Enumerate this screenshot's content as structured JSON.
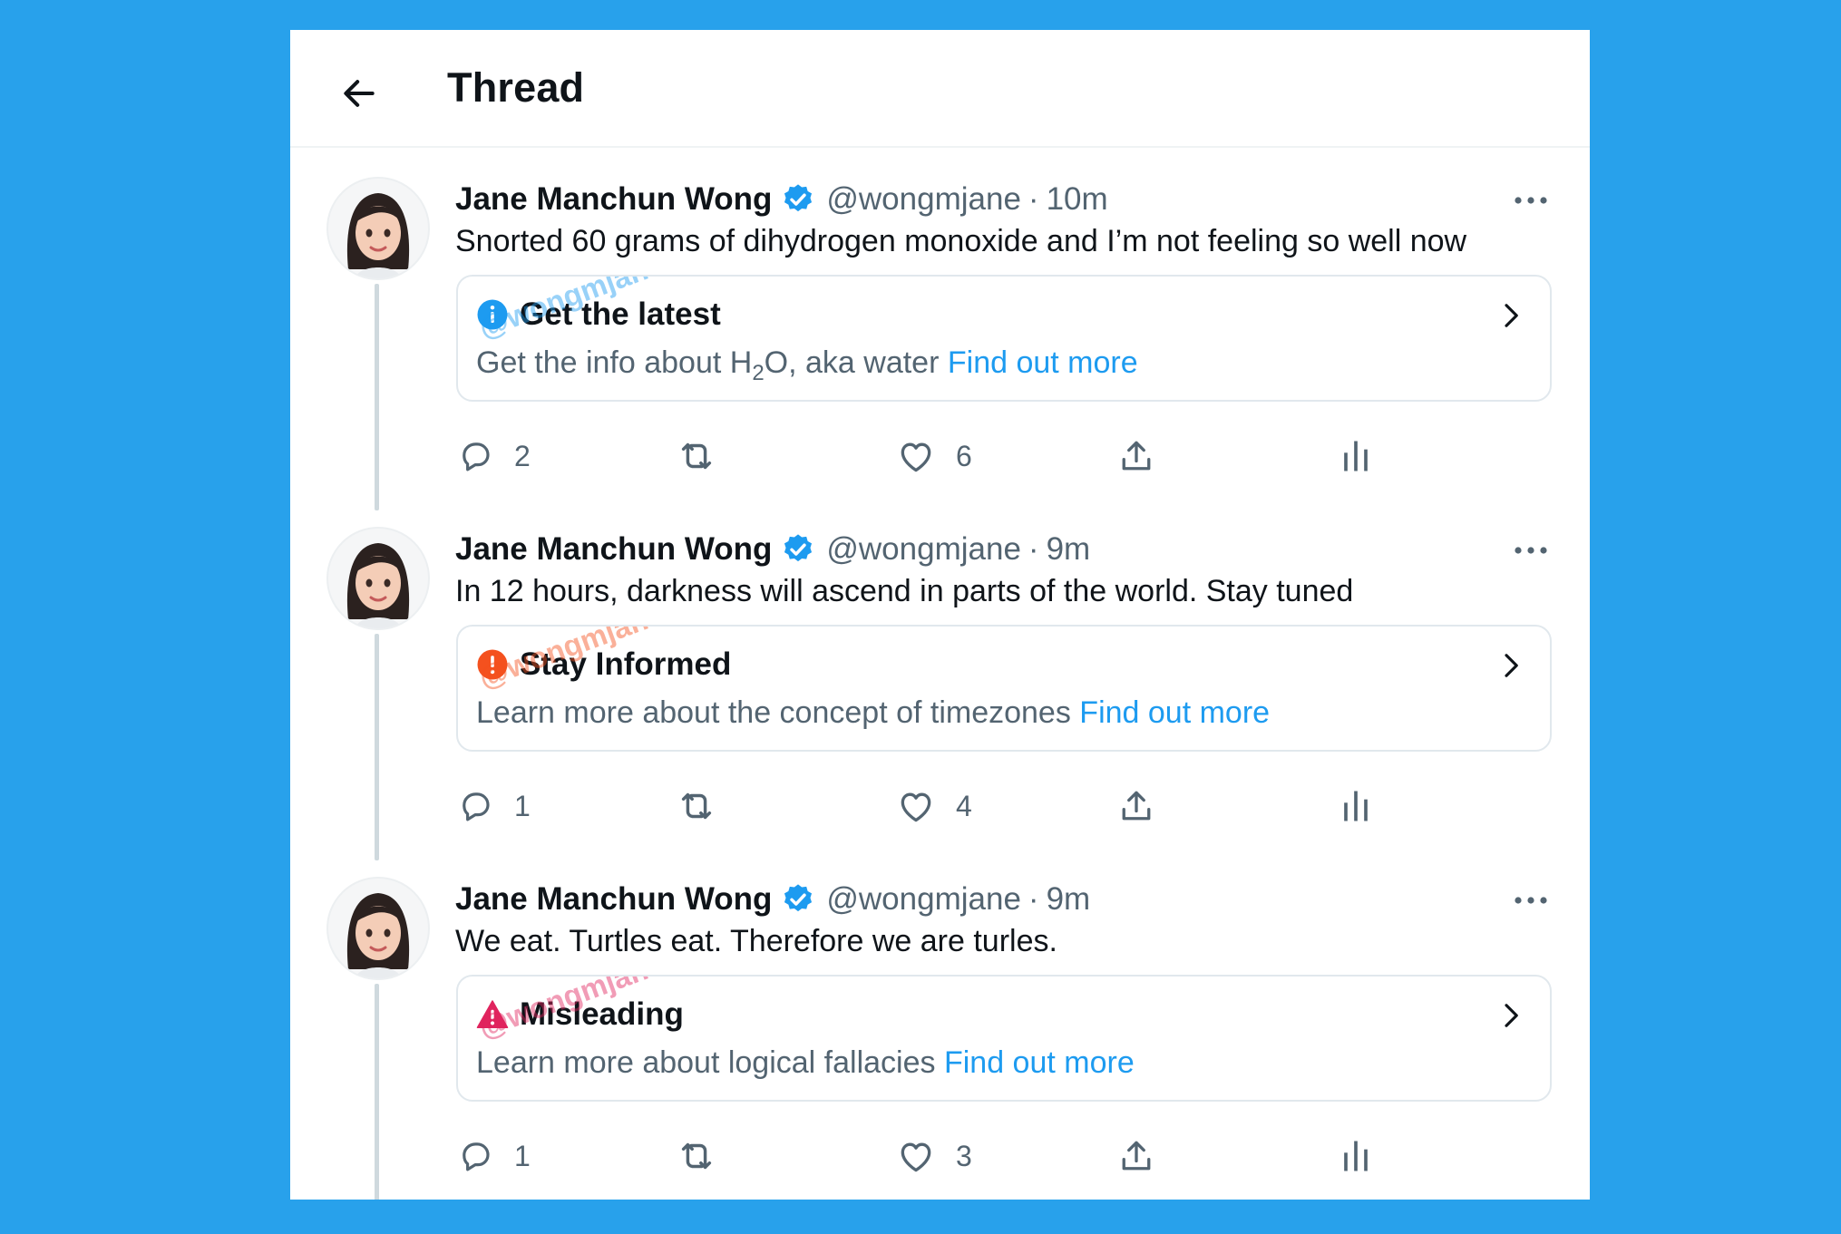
{
  "header": {
    "title": "Thread"
  },
  "colors": {
    "background": "#28a1eb",
    "accent": "#1d9bf0",
    "info": "#1d9bf0",
    "warning": "#f4511e",
    "misleading": "#e0245e"
  },
  "watermark_text": "@wongmjane",
  "tweets": [
    {
      "name": "Jane Manchun Wong",
      "handle": "@wongmjane",
      "dot": "·",
      "time": "10m",
      "text": "Snorted 60 grams of dihydrogen monoxide and I’m not feeling so well now",
      "notice": {
        "icon": "info-icon",
        "title": "Get the latest",
        "desc_pre": "Get the info about H",
        "desc_sub": "2",
        "desc_post": "O, aka water ",
        "link": "Find out more",
        "watermark_color": "#1d9bf0"
      },
      "replies": "2",
      "retweets": "",
      "likes": "6"
    },
    {
      "name": "Jane Manchun Wong",
      "handle": "@wongmjane",
      "dot": "·",
      "time": "9m",
      "text": "In 12 hours, darkness will ascend in parts of the world. Stay tuned",
      "notice": {
        "icon": "alert-icon",
        "title": "Stay Informed",
        "desc_pre": "Learn more about the concept of timezones ",
        "desc_sub": "",
        "desc_post": "",
        "link": "Find out more",
        "watermark_color": "#f4511e"
      },
      "replies": "1",
      "retweets": "",
      "likes": "4"
    },
    {
      "name": "Jane Manchun Wong",
      "handle": "@wongmjane",
      "dot": "·",
      "time": "9m",
      "text": "We eat. Turtles eat. Therefore we are turles.",
      "notice": {
        "icon": "warning-icon",
        "title": "Misleading",
        "desc_pre": "Learn more about logical fallacies ",
        "desc_sub": "",
        "desc_post": "",
        "link": "Find out more",
        "watermark_color": "#e0245e"
      },
      "replies": "1",
      "retweets": "",
      "likes": "3"
    }
  ]
}
